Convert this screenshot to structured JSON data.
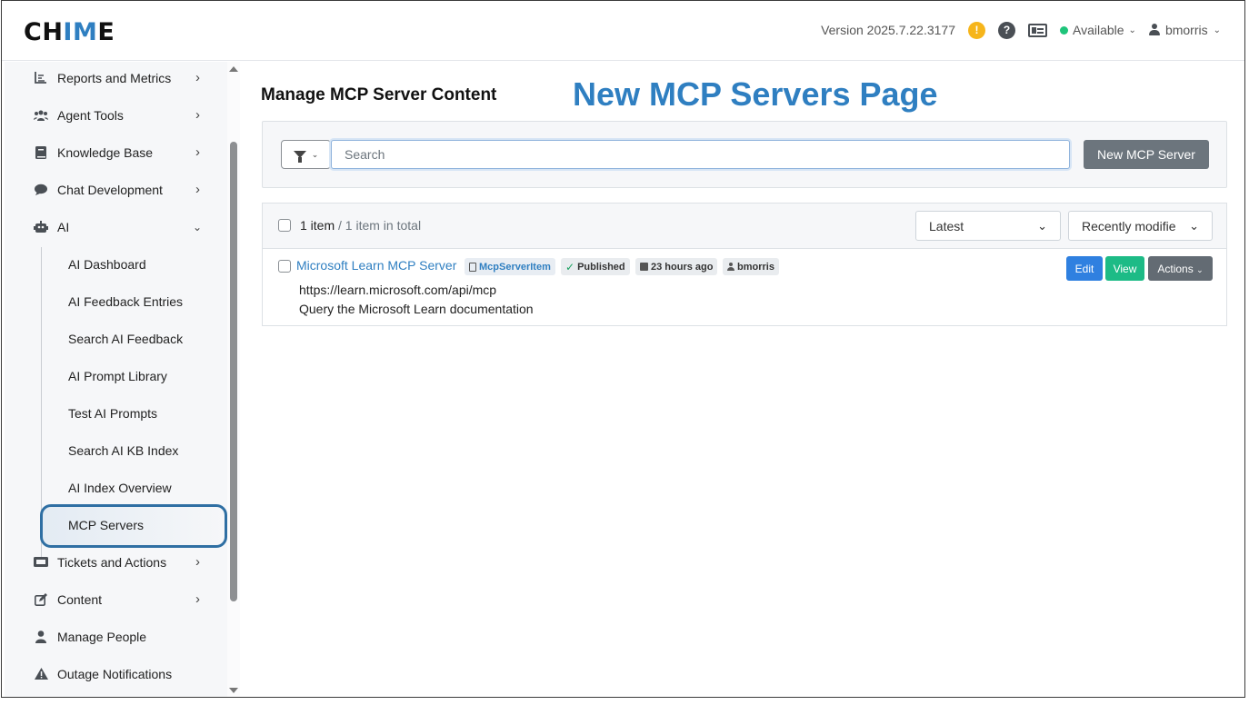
{
  "header": {
    "logo_pre": "CH",
    "logo_mid": "IM",
    "logo_post": "E",
    "version": "Version 2025.7.22.3177",
    "alert_glyph": "!",
    "help_glyph": "?",
    "status": "Available",
    "username": "bmorris",
    "icons": [
      "alert-icon",
      "help-icon",
      "id-card-icon",
      "status-dot-icon",
      "user-icon"
    ]
  },
  "sidebar": {
    "items": [
      {
        "label": "Reports and Metrics",
        "icon": "chart-icon"
      },
      {
        "label": "Agent Tools",
        "icon": "users-icon"
      },
      {
        "label": "Knowledge Base",
        "icon": "book-icon"
      },
      {
        "label": "Chat Development",
        "icon": "chat-icon"
      },
      {
        "label": "AI",
        "icon": "robot-icon"
      }
    ],
    "ai_subitems": [
      "AI Dashboard",
      "AI Feedback Entries",
      "Search AI Feedback",
      "AI Prompt Library",
      "Test AI Prompts",
      "Search AI KB Index",
      "AI Index Overview",
      "MCP Servers"
    ],
    "lower_items": [
      {
        "label": "Tickets and Actions",
        "icon": "ticket-icon"
      },
      {
        "label": "Content",
        "icon": "edit-icon"
      },
      {
        "label": "Manage People",
        "icon": "person-icon"
      },
      {
        "label": "Outage Notifications",
        "icon": "warning-icon"
      }
    ],
    "active_item": "MCP Servers"
  },
  "main": {
    "title": "Manage MCP Server Content",
    "annotation": "New MCP Servers Page",
    "search_placeholder": "Search",
    "new_button": "New MCP Server",
    "count_bold": "1 item",
    "count_muted": "/ 1 item in total",
    "sort_primary": "Latest",
    "sort_secondary": "Recently modifie",
    "rows": [
      {
        "title": "Microsoft Learn MCP Server",
        "type_badge": "McpServerItem",
        "status_badge": "Published",
        "time_badge": "23 hours ago",
        "user_badge": "bmorris",
        "url": "https://learn.microsoft.com/api/mcp",
        "description": "Query the Microsoft Learn documentation",
        "actions": {
          "edit": "Edit",
          "view": "View",
          "more": "Actions"
        }
      }
    ]
  }
}
